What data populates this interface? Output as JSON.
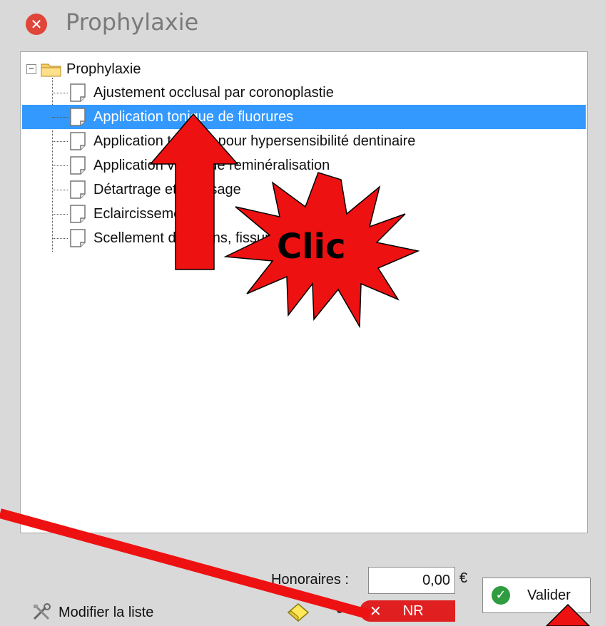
{
  "window": {
    "title": "Prophylaxie"
  },
  "tree": {
    "root_label": "Prophylaxie",
    "items": [
      {
        "label": "Ajustement occlusal par coronoplastie",
        "selected": false
      },
      {
        "label": "Application tonique de fluorures",
        "selected": true
      },
      {
        "label": "Application topique pour hypersensibilité dentinaire",
        "selected": false
      },
      {
        "label": "Application vernis de reminéralisation",
        "selected": false
      },
      {
        "label": "Détartrage et polissage",
        "selected": false
      },
      {
        "label": "Eclaircissement",
        "selected": false
      },
      {
        "label": "Scellement de sillons, fissures",
        "selected": false
      }
    ]
  },
  "footer": {
    "honoraires_label": "Honoraires :",
    "honoraires_value": "0,00",
    "currency": "€",
    "validate_label": "Valider",
    "modify_list_label": "Modifier la liste",
    "nr_label": "NR"
  },
  "annotation": {
    "clic_text": "Clic"
  },
  "colors": {
    "selection": "#3399ff",
    "annotation_red": "#ee1111",
    "close_red": "#e0453a",
    "check_green": "#2e9c3f"
  },
  "icons": {
    "close": "close-icon",
    "folder": "folder-icon",
    "document": "document-icon",
    "check": "check-icon",
    "tools": "tools-icon",
    "eraser": "eraser-icon"
  }
}
